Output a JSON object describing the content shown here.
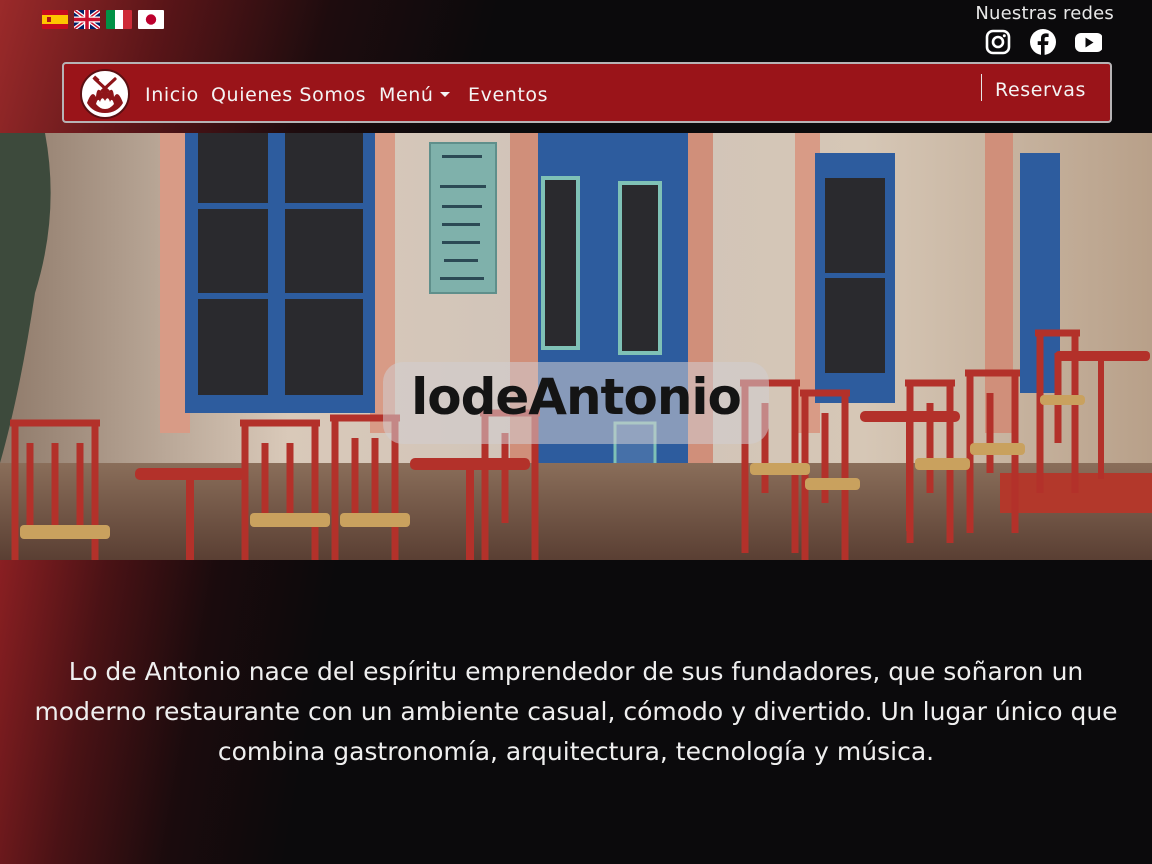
{
  "languages": [
    {
      "name": "Español",
      "icon": "spain-flag-icon"
    },
    {
      "name": "English",
      "icon": "uk-flag-icon"
    },
    {
      "name": "Italiano",
      "icon": "italy-flag-icon"
    },
    {
      "name": "日本語",
      "icon": "japan-flag-icon"
    }
  ],
  "social": {
    "title": "Nuestras redes",
    "icons": [
      "instagram-icon",
      "facebook-icon",
      "youtube-icon"
    ]
  },
  "nav": {
    "logo_icon": "restaurant-logo-icon",
    "items": [
      {
        "label": "Inicio"
      },
      {
        "label": "Quienes Somos"
      },
      {
        "label": "Menú",
        "dropdown": true
      },
      {
        "label": "Eventos"
      }
    ],
    "reservations": "Reservas",
    "background_color": "#9a1419"
  },
  "hero": {
    "title": "lodeAntonio"
  },
  "about": {
    "text": "Lo de Antonio nace del espíritu emprendedor de sus fundadores, que soñaron un moderno restaurante con un ambiente casual, cómodo y divertido. Un lugar único que combina gastronomía, arquitectura, tecnología y música."
  },
  "colors": {
    "brand_red": "#9a1419",
    "background": "#0b0a0c",
    "text": "#efefef"
  }
}
